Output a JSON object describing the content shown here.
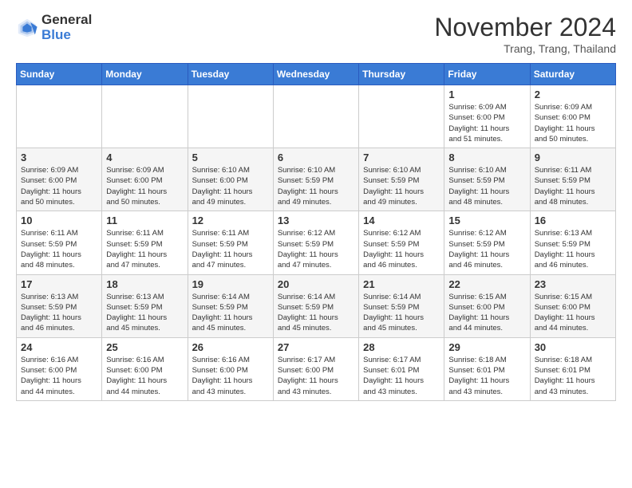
{
  "header": {
    "logo_general": "General",
    "logo_blue": "Blue",
    "month_title": "November 2024",
    "location": "Trang, Trang, Thailand"
  },
  "weekdays": [
    "Sunday",
    "Monday",
    "Tuesday",
    "Wednesday",
    "Thursday",
    "Friday",
    "Saturday"
  ],
  "weeks": [
    [
      {
        "day": "",
        "info": ""
      },
      {
        "day": "",
        "info": ""
      },
      {
        "day": "",
        "info": ""
      },
      {
        "day": "",
        "info": ""
      },
      {
        "day": "",
        "info": ""
      },
      {
        "day": "1",
        "info": "Sunrise: 6:09 AM\nSunset: 6:00 PM\nDaylight: 11 hours\nand 51 minutes."
      },
      {
        "day": "2",
        "info": "Sunrise: 6:09 AM\nSunset: 6:00 PM\nDaylight: 11 hours\nand 50 minutes."
      }
    ],
    [
      {
        "day": "3",
        "info": "Sunrise: 6:09 AM\nSunset: 6:00 PM\nDaylight: 11 hours\nand 50 minutes."
      },
      {
        "day": "4",
        "info": "Sunrise: 6:09 AM\nSunset: 6:00 PM\nDaylight: 11 hours\nand 50 minutes."
      },
      {
        "day": "5",
        "info": "Sunrise: 6:10 AM\nSunset: 6:00 PM\nDaylight: 11 hours\nand 49 minutes."
      },
      {
        "day": "6",
        "info": "Sunrise: 6:10 AM\nSunset: 5:59 PM\nDaylight: 11 hours\nand 49 minutes."
      },
      {
        "day": "7",
        "info": "Sunrise: 6:10 AM\nSunset: 5:59 PM\nDaylight: 11 hours\nand 49 minutes."
      },
      {
        "day": "8",
        "info": "Sunrise: 6:10 AM\nSunset: 5:59 PM\nDaylight: 11 hours\nand 48 minutes."
      },
      {
        "day": "9",
        "info": "Sunrise: 6:11 AM\nSunset: 5:59 PM\nDaylight: 11 hours\nand 48 minutes."
      }
    ],
    [
      {
        "day": "10",
        "info": "Sunrise: 6:11 AM\nSunset: 5:59 PM\nDaylight: 11 hours\nand 48 minutes."
      },
      {
        "day": "11",
        "info": "Sunrise: 6:11 AM\nSunset: 5:59 PM\nDaylight: 11 hours\nand 47 minutes."
      },
      {
        "day": "12",
        "info": "Sunrise: 6:11 AM\nSunset: 5:59 PM\nDaylight: 11 hours\nand 47 minutes."
      },
      {
        "day": "13",
        "info": "Sunrise: 6:12 AM\nSunset: 5:59 PM\nDaylight: 11 hours\nand 47 minutes."
      },
      {
        "day": "14",
        "info": "Sunrise: 6:12 AM\nSunset: 5:59 PM\nDaylight: 11 hours\nand 46 minutes."
      },
      {
        "day": "15",
        "info": "Sunrise: 6:12 AM\nSunset: 5:59 PM\nDaylight: 11 hours\nand 46 minutes."
      },
      {
        "day": "16",
        "info": "Sunrise: 6:13 AM\nSunset: 5:59 PM\nDaylight: 11 hours\nand 46 minutes."
      }
    ],
    [
      {
        "day": "17",
        "info": "Sunrise: 6:13 AM\nSunset: 5:59 PM\nDaylight: 11 hours\nand 46 minutes."
      },
      {
        "day": "18",
        "info": "Sunrise: 6:13 AM\nSunset: 5:59 PM\nDaylight: 11 hours\nand 45 minutes."
      },
      {
        "day": "19",
        "info": "Sunrise: 6:14 AM\nSunset: 5:59 PM\nDaylight: 11 hours\nand 45 minutes."
      },
      {
        "day": "20",
        "info": "Sunrise: 6:14 AM\nSunset: 5:59 PM\nDaylight: 11 hours\nand 45 minutes."
      },
      {
        "day": "21",
        "info": "Sunrise: 6:14 AM\nSunset: 5:59 PM\nDaylight: 11 hours\nand 45 minutes."
      },
      {
        "day": "22",
        "info": "Sunrise: 6:15 AM\nSunset: 6:00 PM\nDaylight: 11 hours\nand 44 minutes."
      },
      {
        "day": "23",
        "info": "Sunrise: 6:15 AM\nSunset: 6:00 PM\nDaylight: 11 hours\nand 44 minutes."
      }
    ],
    [
      {
        "day": "24",
        "info": "Sunrise: 6:16 AM\nSunset: 6:00 PM\nDaylight: 11 hours\nand 44 minutes."
      },
      {
        "day": "25",
        "info": "Sunrise: 6:16 AM\nSunset: 6:00 PM\nDaylight: 11 hours\nand 44 minutes."
      },
      {
        "day": "26",
        "info": "Sunrise: 6:16 AM\nSunset: 6:00 PM\nDaylight: 11 hours\nand 43 minutes."
      },
      {
        "day": "27",
        "info": "Sunrise: 6:17 AM\nSunset: 6:00 PM\nDaylight: 11 hours\nand 43 minutes."
      },
      {
        "day": "28",
        "info": "Sunrise: 6:17 AM\nSunset: 6:01 PM\nDaylight: 11 hours\nand 43 minutes."
      },
      {
        "day": "29",
        "info": "Sunrise: 6:18 AM\nSunset: 6:01 PM\nDaylight: 11 hours\nand 43 minutes."
      },
      {
        "day": "30",
        "info": "Sunrise: 6:18 AM\nSunset: 6:01 PM\nDaylight: 11 hours\nand 43 minutes."
      }
    ]
  ]
}
